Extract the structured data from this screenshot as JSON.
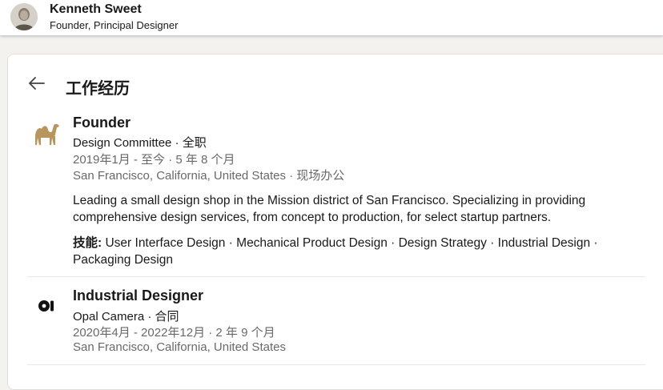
{
  "profile": {
    "name": "Kenneth Sweet",
    "headline": "Founder, Principal Designer"
  },
  "page": {
    "back_icon": "arrow-left-icon",
    "title": "工作经历"
  },
  "experiences": [
    {
      "logo_icon": "camel-logo-icon",
      "logo_color": "#b8955a",
      "title": "Founder",
      "company_line": "Design Committee · 全职",
      "dates": "2019年1月 - 至今 · 5 年 8 个月",
      "location": "San Francisco, California, United States · 现场办公",
      "description": "Leading a small design shop in the Mission district of San Francisco. Specializing in providing comprehensive design services, from concept to production, for select startup partners.",
      "skills_label": "技能:",
      "skills": " User Interface Design · Mechanical Product Design · Design Strategy · Industrial Design · Packaging Design"
    },
    {
      "logo_icon": "opal-camera-logo-icon",
      "logo_color": "#111111",
      "title": "Industrial Designer",
      "company_line": "Opal Camera · 合同",
      "dates": "2020年4月 - 2022年12月 · 2 年 9 个月",
      "location": "San Francisco, California, United States"
    }
  ]
}
